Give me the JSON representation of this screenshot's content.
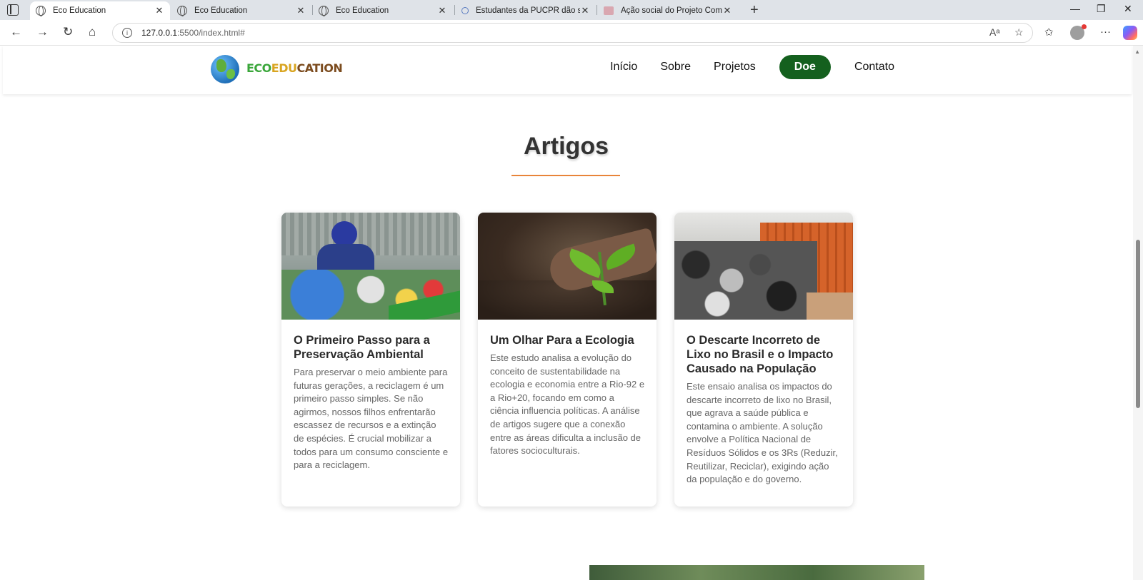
{
  "browser": {
    "tabs": [
      {
        "title": "Eco Education",
        "active": true
      },
      {
        "title": "Eco Education",
        "active": false
      },
      {
        "title": "Eco Education",
        "active": false
      },
      {
        "title": "Estudantes da PUCPR dão suporte",
        "active": false
      },
      {
        "title": "Ação social do Projeto Comunitário",
        "active": false
      }
    ],
    "url_host": "127.0.0.1",
    "url_rest": ":5500/index.html#",
    "icons": [
      "sidebar-icon",
      "back-icon",
      "forward-icon",
      "refresh-icon",
      "home-icon",
      "info-icon",
      "read-aloud-icon",
      "star-icon",
      "favorites-icon",
      "profile-icon",
      "more-icon",
      "copilot-icon",
      "minimize-icon",
      "restore-icon",
      "close-icon"
    ]
  },
  "site": {
    "logo_text": {
      "eco": "ECO",
      "mid": "EDU",
      "edu": "CATION"
    },
    "nav": [
      {
        "label": "Início"
      },
      {
        "label": "Sobre"
      },
      {
        "label": "Projetos"
      },
      {
        "label": "Doe"
      },
      {
        "label": "Contato"
      }
    ],
    "accent_color": "#14601e",
    "underline_color": "#e8843a"
  },
  "articles": {
    "title": "Artigos",
    "cards": [
      {
        "title": "O Primeiro Passo para a Preservação Ambiental",
        "text": "Para preservar o meio ambiente para futuras gerações, a reciclagem é um primeiro passo simples. Se não agirmos, nossos filhos enfrentarão escassez de recursos e a extinção de espécies. É crucial mobilizar a todos para um consumo consciente e para a reciclagem."
      },
      {
        "title": "Um Olhar Para a Ecologia",
        "text": "Este estudo analisa a evolução do conceito de sustentabilidade na ecologia e economia entre a Rio-92 e a Rio+20, focando em como a ciência influencia políticas. A análise de artigos sugere que a conexão entre as áreas dificulta a inclusão de fatores socioculturais."
      },
      {
        "title": "O Descarte Incorreto de Lixo no Brasil e o Impacto Causado na População",
        "text": "Este ensaio analisa os impactos do descarte incorreto de lixo no Brasil, que agrava a saúde pública e contamina o ambiente. A solução envolve a Política Nacional de Resíduos Sólidos e os 3Rs (Reduzir, Reutilizar, Reciclar), exigindo ação da população e do governo."
      }
    ]
  }
}
